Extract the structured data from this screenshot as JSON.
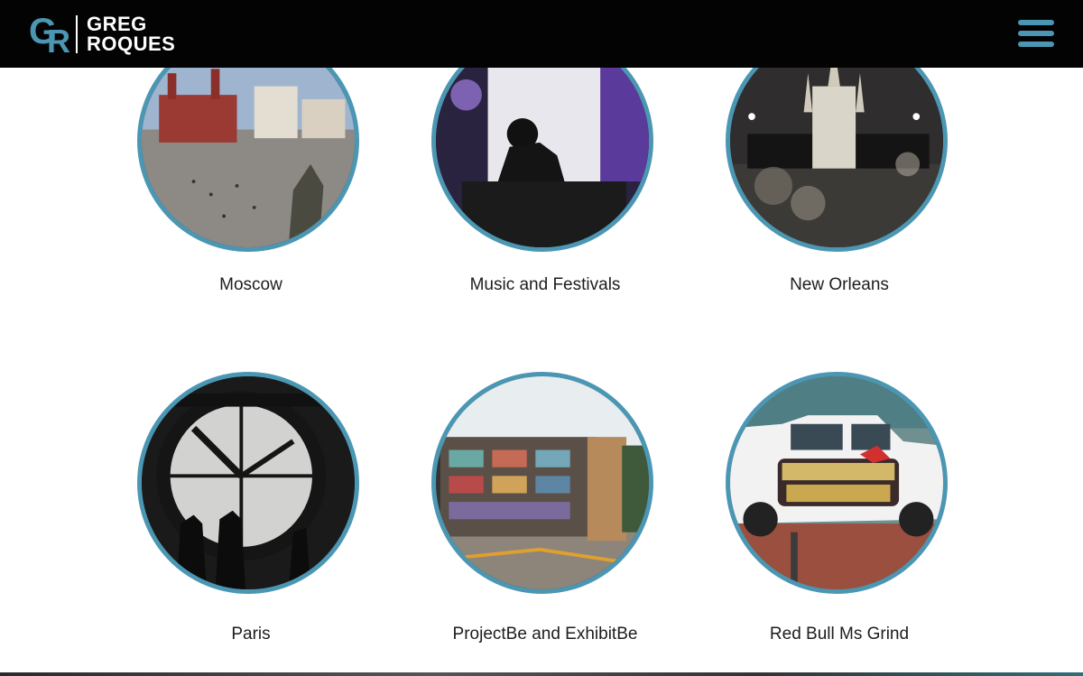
{
  "header": {
    "logo_monogram_g": "G",
    "logo_monogram_r": "R",
    "logo_line1": "GREG",
    "logo_line2": "ROQUES",
    "menu_icon": "hamburger-menu-icon",
    "accent_color": "#4b97b3",
    "background_color": "#030303"
  },
  "gallery": {
    "items": [
      {
        "label": "Moscow",
        "image": "moscow-red-square"
      },
      {
        "label": "Music and Festivals",
        "image": "dj-on-stage"
      },
      {
        "label": "New Orleans",
        "image": "st-louis-cathedral-night"
      },
      {
        "label": "Paris",
        "image": "orsay-clock-window"
      },
      {
        "label": "ProjectBe and ExhibitBe",
        "image": "graffiti-building"
      },
      {
        "label": "Red Bull Ms Grind",
        "image": "red-bull-mississippi-grind-truck"
      }
    ]
  }
}
